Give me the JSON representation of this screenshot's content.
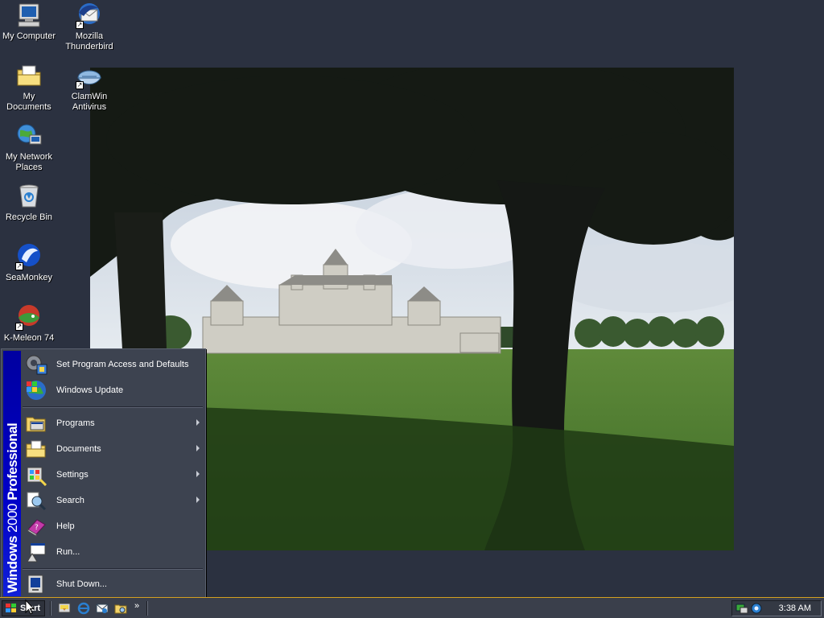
{
  "desktop": {
    "icons": [
      {
        "label": "My Computer",
        "icon": "computer-icon"
      },
      {
        "label": "My Documents",
        "icon": "folder-icon"
      },
      {
        "label": "My Network Places",
        "icon": "network-icon"
      },
      {
        "label": "Recycle Bin",
        "icon": "recycle-bin-icon"
      },
      {
        "label": "SeaMonkey",
        "icon": "seamonkey-icon"
      },
      {
        "label": "K-Meleon 74",
        "icon": "kmeleon-icon"
      },
      {
        "label": "Mozilla Thunderbird",
        "icon": "thunderbird-icon"
      },
      {
        "label": "ClamWin Antivirus",
        "icon": "clamwin-icon"
      }
    ]
  },
  "start_menu": {
    "banner_bold": "Windows",
    "banner_light": "2000",
    "banner_edition": "Professional",
    "items": [
      {
        "label": "Set Program Access and Defaults",
        "icon": "program-access-icon",
        "submenu": false
      },
      {
        "label": "Windows Update",
        "icon": "windows-update-icon",
        "submenu": false
      },
      {
        "label": "Programs",
        "icon": "programs-icon",
        "submenu": true
      },
      {
        "label": "Documents",
        "icon": "documents-icon",
        "submenu": true
      },
      {
        "label": "Settings",
        "icon": "settings-icon",
        "submenu": true
      },
      {
        "label": "Search",
        "icon": "search-icon",
        "submenu": true
      },
      {
        "label": "Help",
        "icon": "help-icon",
        "submenu": false
      },
      {
        "label": "Run...",
        "icon": "run-icon",
        "submenu": false
      },
      {
        "label": "Shut Down...",
        "icon": "shutdown-icon",
        "submenu": false
      }
    ]
  },
  "taskbar": {
    "start_label": "Start",
    "quick_launch_more": "»",
    "clock": "3:38 AM"
  },
  "colors": {
    "desktop_bg": "#2b3140",
    "menu_bg": "#3d4350",
    "banner_blue": "#0000c8",
    "taskbar_bg": "#3a3f4b",
    "taskbar_accent": "#d4a020"
  }
}
